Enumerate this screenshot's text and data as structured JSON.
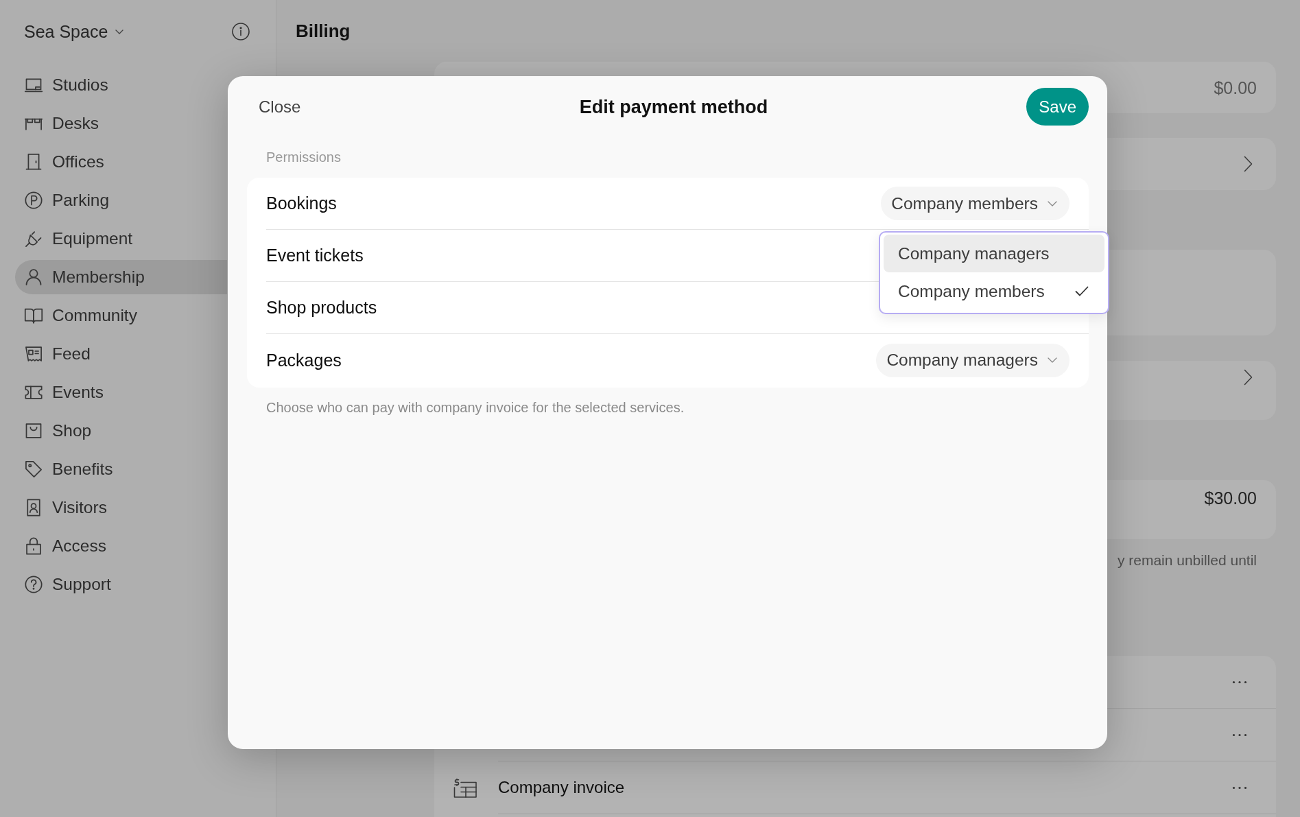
{
  "sidebar": {
    "workspace": "Sea Space",
    "items": [
      {
        "label": "Studios",
        "selected": false
      },
      {
        "label": "Desks",
        "selected": false
      },
      {
        "label": "Offices",
        "selected": false
      },
      {
        "label": "Parking",
        "selected": false
      },
      {
        "label": "Equipment",
        "selected": false
      },
      {
        "label": "Membership",
        "selected": true
      },
      {
        "label": "Community",
        "selected": false
      },
      {
        "label": "Feed",
        "selected": false
      },
      {
        "label": "Events",
        "selected": false
      },
      {
        "label": "Shop",
        "selected": false
      },
      {
        "label": "Benefits",
        "selected": false
      },
      {
        "label": "Visitors",
        "selected": false
      },
      {
        "label": "Access",
        "selected": false
      },
      {
        "label": "Support",
        "selected": false
      }
    ]
  },
  "page": {
    "title": "Billing",
    "cards": [
      {
        "kind": "amount",
        "amount": "$0.00"
      },
      {
        "kind": "link"
      },
      {
        "kind": "plain"
      },
      {
        "kind": "link"
      },
      {
        "kind": "amount",
        "amount": "$30.00"
      }
    ],
    "note": "y remain unbilled until",
    "payment_methods": [
      {
        "kind": "plain"
      },
      {
        "kind": "plain"
      },
      {
        "kind": "invoice",
        "label": "Company invoice"
      }
    ]
  },
  "dialog": {
    "close": "Close",
    "title": "Edit payment method",
    "save": "Save",
    "section": "Permissions",
    "rows": [
      {
        "label": "Bookings",
        "value": "Company members",
        "expanded": false
      },
      {
        "label": "Event tickets",
        "expanded": true,
        "menu": [
          {
            "label": "Company managers",
            "highlighted": true,
            "selected": false
          },
          {
            "label": "Company members",
            "highlighted": false,
            "selected": true
          }
        ]
      },
      {
        "label": "Shop products",
        "expanded": false
      },
      {
        "label": "Packages",
        "value": "Company managers",
        "expanded": false
      }
    ],
    "hint": "Choose who can pay with company invoice for the selected services."
  }
}
